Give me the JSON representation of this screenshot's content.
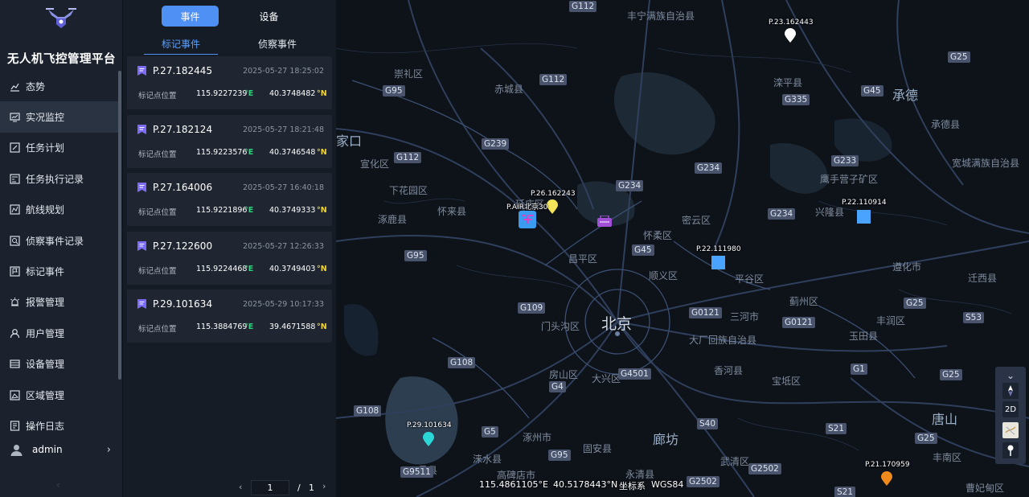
{
  "app": {
    "title": "无人机飞控管理平台"
  },
  "sidebar": {
    "items": [
      {
        "label": "态势",
        "icon": "chart-icon"
      },
      {
        "label": "实况监控",
        "icon": "monitor-icon"
      },
      {
        "label": "任务计划",
        "icon": "calendar-edit-icon"
      },
      {
        "label": "任务执行记录",
        "icon": "record-icon"
      },
      {
        "label": "航线规划",
        "icon": "route-icon"
      },
      {
        "label": "侦察事件记录",
        "icon": "scout-record-icon"
      },
      {
        "label": "标记事件",
        "icon": "mark-event-icon"
      },
      {
        "label": "报警管理",
        "icon": "alarm-icon"
      },
      {
        "label": "用户管理",
        "icon": "user-icon"
      },
      {
        "label": "设备管理",
        "icon": "device-icon"
      },
      {
        "label": "区域管理",
        "icon": "area-icon"
      },
      {
        "label": "操作日志",
        "icon": "log-icon"
      }
    ],
    "active_index": 1,
    "user": {
      "name": "admin"
    }
  },
  "panel": {
    "tabs": [
      "事件",
      "设备"
    ],
    "subtabs": [
      "标记事件",
      "侦察事件"
    ],
    "events": [
      {
        "id": "P.27.182445",
        "time": "2025-05-27 18:25:02",
        "label": "标记点位置",
        "lon": "115.9227239",
        "lon_unit": "°E",
        "lat": "40.3748482",
        "lat_unit": "°N"
      },
      {
        "id": "P.27.182124",
        "time": "2025-05-27 18:21:48",
        "label": "标记点位置",
        "lon": "115.9223576",
        "lon_unit": "°E",
        "lat": "40.3746548",
        "lat_unit": "°N"
      },
      {
        "id": "P.27.164006",
        "time": "2025-05-27 16:40:18",
        "label": "标记点位置",
        "lon": "115.9221896",
        "lon_unit": "°E",
        "lat": "40.3749333",
        "lat_unit": "°N"
      },
      {
        "id": "P.27.122600",
        "time": "2025-05-27 12:26:33",
        "label": "标记点位置",
        "lon": "115.9224468",
        "lon_unit": "°E",
        "lat": "40.3749403",
        "lat_unit": "°N"
      },
      {
        "id": "P.29.101634",
        "time": "2025-05-29 10:17:33",
        "label": "标记点位置",
        "lon": "115.3884769",
        "lon_unit": "°E",
        "lat": "39.4671588",
        "lat_unit": "°N"
      }
    ],
    "pager": {
      "current": "1",
      "separator": "/",
      "total": "1"
    }
  },
  "map": {
    "places_big": [
      "北京",
      "承德",
      "廊坊",
      "唐山"
    ],
    "places": [
      "丰宁满族自治县",
      "崇礼区",
      "赤城县",
      "滦平县",
      "宽城满族自治县",
      "承德县",
      "宣化区",
      "下花园区",
      "怀来县",
      "涿鹿县",
      "延庆区",
      "密云区",
      "怀柔区",
      "兴隆县",
      "鹰手营子矿区",
      "遵化市",
      "迁西县",
      "昌平区",
      "顺义区",
      "平谷区",
      "蓟州区",
      "三河市",
      "门头沟区",
      "大厂回族自治县",
      "玉田县",
      "丰润区",
      "房山区",
      "大兴区",
      "香河县",
      "宝坻区",
      "涿州市",
      "固安县",
      "武清区",
      "涞水县",
      "易县",
      "高碑店市",
      "永清县",
      "丰南区",
      "曹妃甸区",
      "家口"
    ],
    "roads": [
      "G112",
      "G95",
      "G112",
      "G25",
      "G45",
      "G335",
      "G239",
      "G112",
      "G234",
      "G234",
      "G233",
      "G234",
      "G95",
      "G45",
      "G109",
      "G0121",
      "G0121",
      "G25",
      "S53",
      "G108",
      "G4501",
      "G1",
      "G25",
      "G4",
      "G108",
      "G5",
      "G95",
      "S40",
      "S21",
      "G25",
      "G9511",
      "G2502",
      "G2502",
      "S21"
    ],
    "markers": [
      {
        "label": "P.23.162443",
        "color": "#ffffff",
        "kind": "pin"
      },
      {
        "label": "P.26.162243",
        "color": "#f3e35b",
        "kind": "pin"
      },
      {
        "label": "P.AIR北京30",
        "color": "#3b9bf1",
        "kind": "drone"
      },
      {
        "label": "P.22.110914",
        "color": "#4aa3ff",
        "kind": "square"
      },
      {
        "label": "P.22.111980",
        "color": "#4aa3ff",
        "kind": "square"
      },
      {
        "label": "P.29.101634",
        "color": "#2ad6d6",
        "kind": "pin"
      },
      {
        "label": "P.21.170959",
        "color": "#f08a1c",
        "kind": "pin"
      }
    ],
    "tools": [
      "collapse-icon",
      "compass-icon",
      "2D",
      "basemap-icon",
      "marker-tool-icon"
    ],
    "coords": {
      "lon": "115.4861105°E",
      "lat": "40.5178443°N",
      "crs_label": "坐标系",
      "crs_value": "WGS84"
    }
  },
  "colors": {
    "accent": "#4f90f4",
    "panel_bg": "#161c26",
    "sidebar_bg": "#1b222e",
    "map_bg": "#0e1219"
  }
}
